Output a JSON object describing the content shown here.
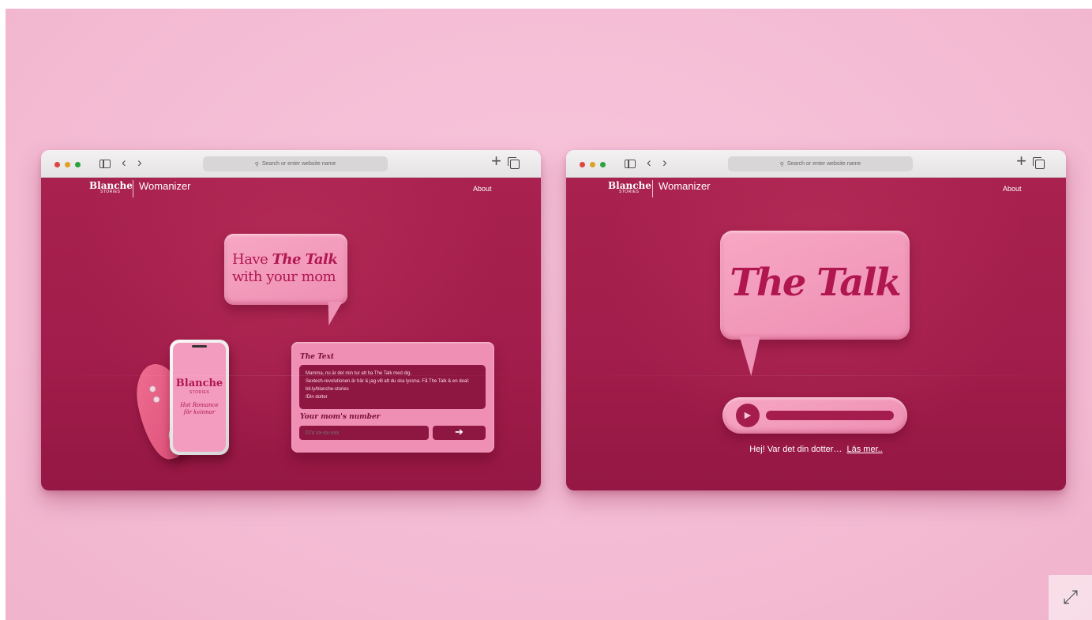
{
  "browser": {
    "url_placeholder": "Search or enter website name"
  },
  "site": {
    "logo_blanche": "Blanche",
    "logo_stories": "STORIES",
    "logo_womanizer": "Womanizer",
    "about": "About"
  },
  "left_page": {
    "bubble_have": "Have",
    "bubble_the_talk": "The Talk",
    "bubble_line2": "with your mom",
    "phone_blanche": "Blanche",
    "phone_stories": "STORIES",
    "phone_tagline_1": "Hot Romance",
    "phone_tagline_2": "för kvinnor",
    "card_title": "The Text",
    "message_line_1": "Mamma, nu är det min tur att ha The Talk med dig.",
    "message_line_2": "Sextech-revolutionen är här & jag vill att du ska lyssna. Få The Talk & en deal: bit.ly/blanche-stories",
    "message_line_3": "/Din dotter",
    "number_label": "Your mom's number",
    "number_placeholder": "07x xx-xx-xxx",
    "send_symbol": "➔"
  },
  "right_page": {
    "bubble_title": "The Talk",
    "caption": "Hej! Var det din dotter…",
    "read_more": "Läs mer.."
  },
  "icons": {
    "expand": "expand-icon"
  }
}
